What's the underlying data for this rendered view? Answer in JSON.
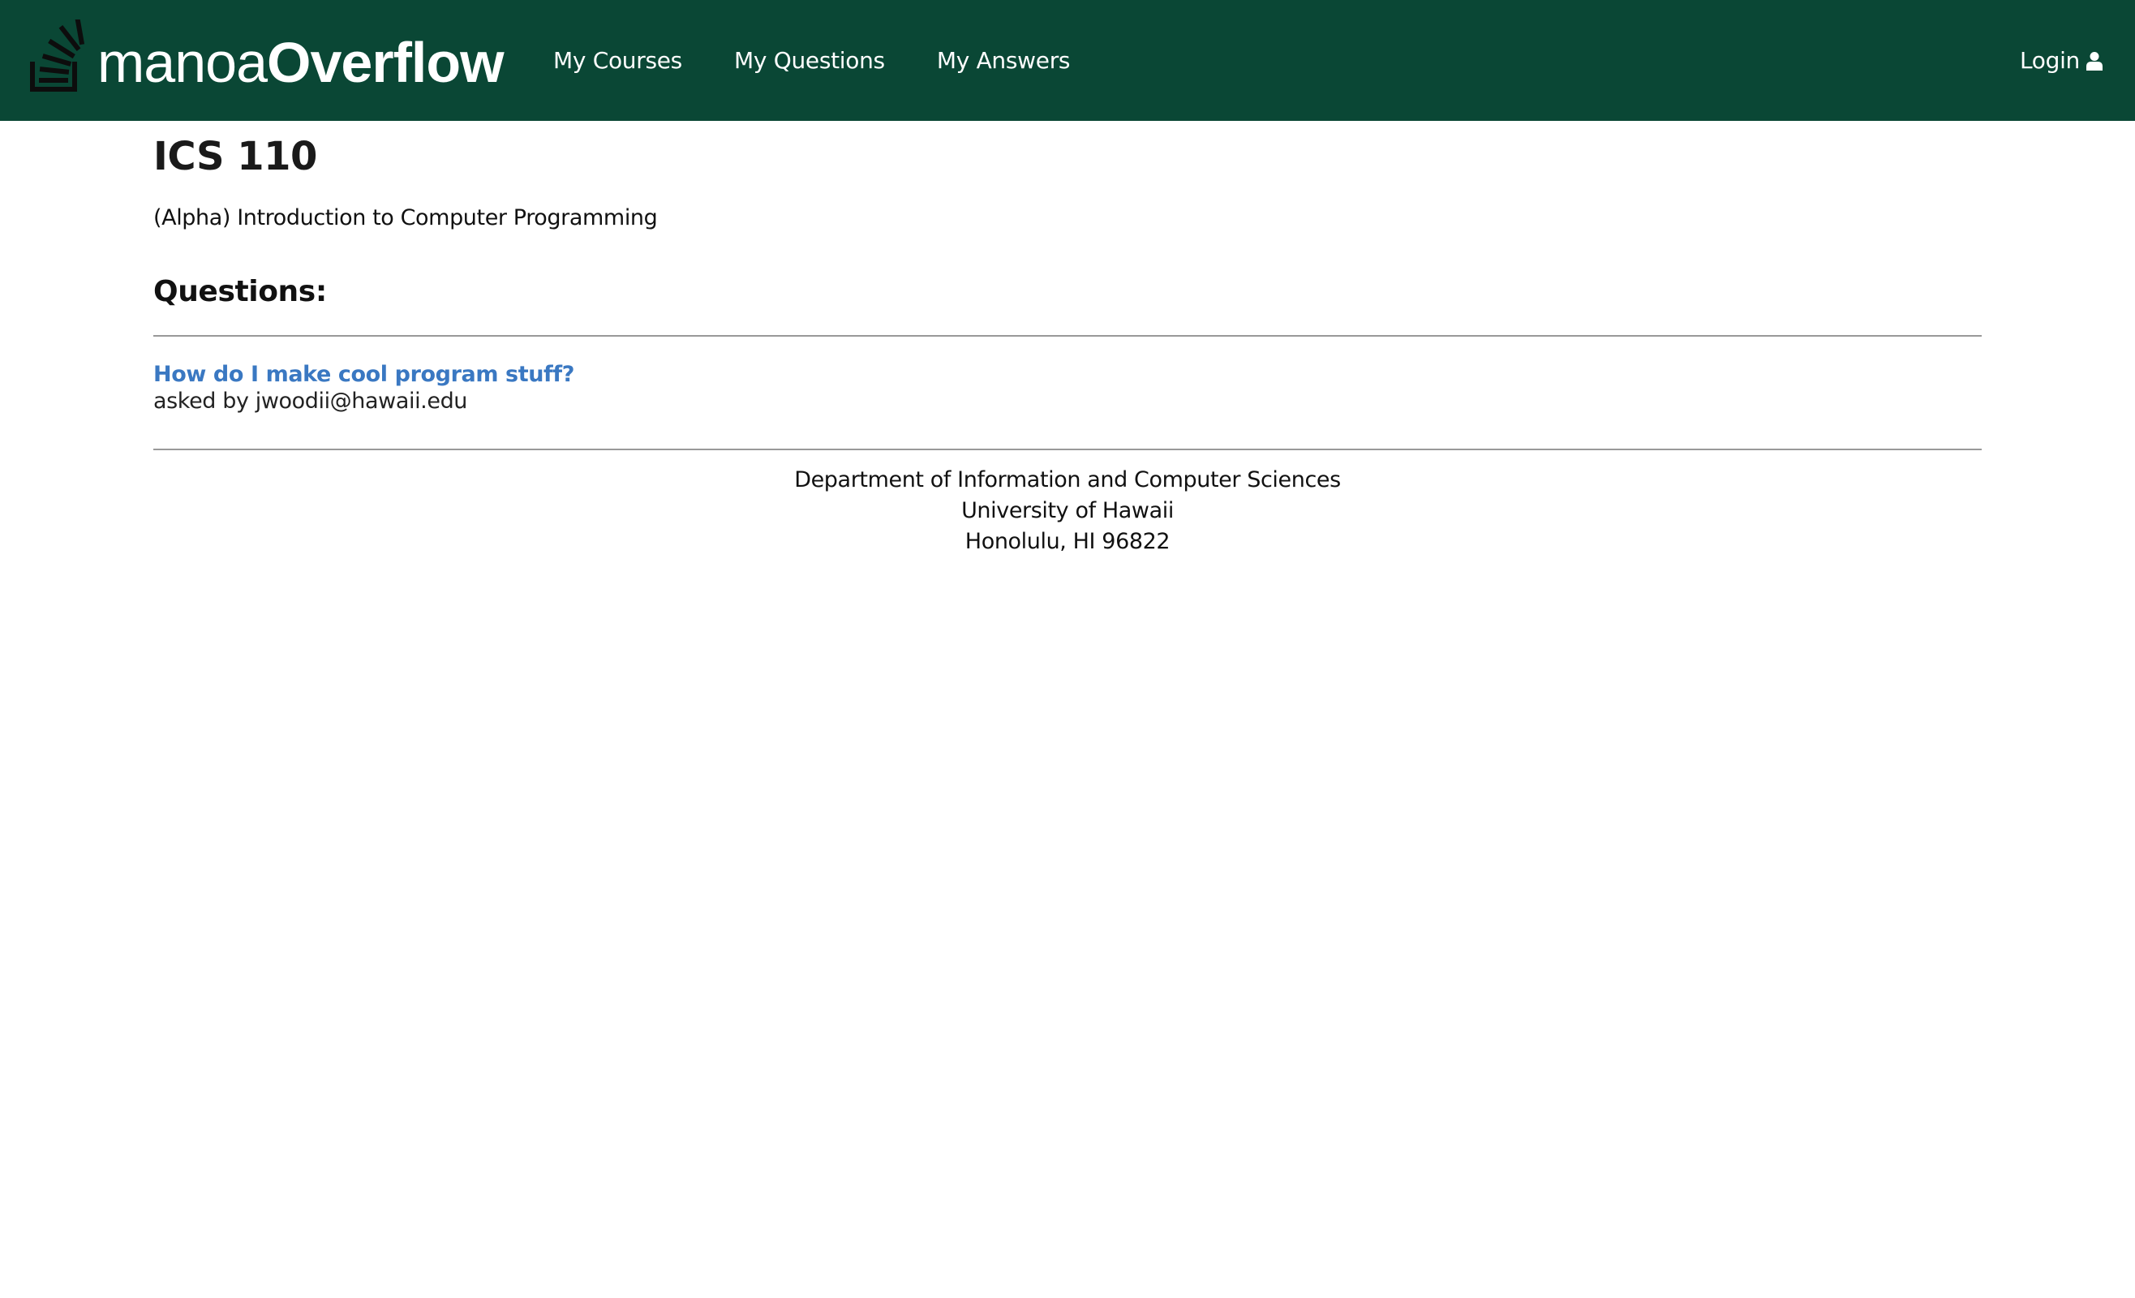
{
  "navbar": {
    "brand_prefix": "manoa",
    "brand_suffix": "Overflow",
    "links": [
      {
        "label": "My Courses"
      },
      {
        "label": "My Questions"
      },
      {
        "label": "My Answers"
      }
    ],
    "login_label": "Login",
    "login_icon": "user-icon",
    "background_color": "#0a4735"
  },
  "course": {
    "code": "ICS 110",
    "description": "(Alpha) Introduction to Computer Programming"
  },
  "questions": {
    "heading": "Questions:",
    "items": [
      {
        "title": "How do I make cool program stuff?",
        "meta": "asked by jwoodii@hawaii.edu"
      }
    ],
    "link_color": "#3a78c2"
  },
  "footer": {
    "line1": "Department of Information and Computer Sciences",
    "line2": "University of Hawaii",
    "line3": "Honolulu, HI 96822"
  }
}
